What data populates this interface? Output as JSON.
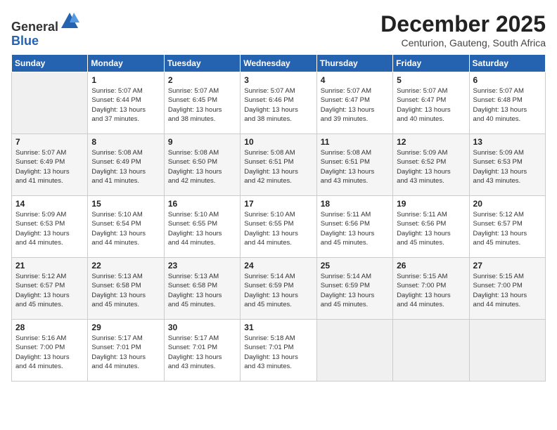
{
  "header": {
    "logo_general": "General",
    "logo_blue": "Blue",
    "month_title": "December 2025",
    "location": "Centurion, Gauteng, South Africa"
  },
  "days_of_week": [
    "Sunday",
    "Monday",
    "Tuesday",
    "Wednesday",
    "Thursday",
    "Friday",
    "Saturday"
  ],
  "weeks": [
    [
      {
        "day": "",
        "empty": true
      },
      {
        "day": "1",
        "sunrise": "Sunrise: 5:07 AM",
        "sunset": "Sunset: 6:44 PM",
        "daylight": "Daylight: 13 hours and 37 minutes."
      },
      {
        "day": "2",
        "sunrise": "Sunrise: 5:07 AM",
        "sunset": "Sunset: 6:45 PM",
        "daylight": "Daylight: 13 hours and 38 minutes."
      },
      {
        "day": "3",
        "sunrise": "Sunrise: 5:07 AM",
        "sunset": "Sunset: 6:46 PM",
        "daylight": "Daylight: 13 hours and 38 minutes."
      },
      {
        "day": "4",
        "sunrise": "Sunrise: 5:07 AM",
        "sunset": "Sunset: 6:47 PM",
        "daylight": "Daylight: 13 hours and 39 minutes."
      },
      {
        "day": "5",
        "sunrise": "Sunrise: 5:07 AM",
        "sunset": "Sunset: 6:47 PM",
        "daylight": "Daylight: 13 hours and 40 minutes."
      },
      {
        "day": "6",
        "sunrise": "Sunrise: 5:07 AM",
        "sunset": "Sunset: 6:48 PM",
        "daylight": "Daylight: 13 hours and 40 minutes."
      }
    ],
    [
      {
        "day": "7",
        "sunrise": "Sunrise: 5:07 AM",
        "sunset": "Sunset: 6:49 PM",
        "daylight": "Daylight: 13 hours and 41 minutes."
      },
      {
        "day": "8",
        "sunrise": "Sunrise: 5:08 AM",
        "sunset": "Sunset: 6:49 PM",
        "daylight": "Daylight: 13 hours and 41 minutes."
      },
      {
        "day": "9",
        "sunrise": "Sunrise: 5:08 AM",
        "sunset": "Sunset: 6:50 PM",
        "daylight": "Daylight: 13 hours and 42 minutes."
      },
      {
        "day": "10",
        "sunrise": "Sunrise: 5:08 AM",
        "sunset": "Sunset: 6:51 PM",
        "daylight": "Daylight: 13 hours and 42 minutes."
      },
      {
        "day": "11",
        "sunrise": "Sunrise: 5:08 AM",
        "sunset": "Sunset: 6:51 PM",
        "daylight": "Daylight: 13 hours and 43 minutes."
      },
      {
        "day": "12",
        "sunrise": "Sunrise: 5:09 AM",
        "sunset": "Sunset: 6:52 PM",
        "daylight": "Daylight: 13 hours and 43 minutes."
      },
      {
        "day": "13",
        "sunrise": "Sunrise: 5:09 AM",
        "sunset": "Sunset: 6:53 PM",
        "daylight": "Daylight: 13 hours and 43 minutes."
      }
    ],
    [
      {
        "day": "14",
        "sunrise": "Sunrise: 5:09 AM",
        "sunset": "Sunset: 6:53 PM",
        "daylight": "Daylight: 13 hours and 44 minutes."
      },
      {
        "day": "15",
        "sunrise": "Sunrise: 5:10 AM",
        "sunset": "Sunset: 6:54 PM",
        "daylight": "Daylight: 13 hours and 44 minutes."
      },
      {
        "day": "16",
        "sunrise": "Sunrise: 5:10 AM",
        "sunset": "Sunset: 6:55 PM",
        "daylight": "Daylight: 13 hours and 44 minutes."
      },
      {
        "day": "17",
        "sunrise": "Sunrise: 5:10 AM",
        "sunset": "Sunset: 6:55 PM",
        "daylight": "Daylight: 13 hours and 44 minutes."
      },
      {
        "day": "18",
        "sunrise": "Sunrise: 5:11 AM",
        "sunset": "Sunset: 6:56 PM",
        "daylight": "Daylight: 13 hours and 45 minutes."
      },
      {
        "day": "19",
        "sunrise": "Sunrise: 5:11 AM",
        "sunset": "Sunset: 6:56 PM",
        "daylight": "Daylight: 13 hours and 45 minutes."
      },
      {
        "day": "20",
        "sunrise": "Sunrise: 5:12 AM",
        "sunset": "Sunset: 6:57 PM",
        "daylight": "Daylight: 13 hours and 45 minutes."
      }
    ],
    [
      {
        "day": "21",
        "sunrise": "Sunrise: 5:12 AM",
        "sunset": "Sunset: 6:57 PM",
        "daylight": "Daylight: 13 hours and 45 minutes."
      },
      {
        "day": "22",
        "sunrise": "Sunrise: 5:13 AM",
        "sunset": "Sunset: 6:58 PM",
        "daylight": "Daylight: 13 hours and 45 minutes."
      },
      {
        "day": "23",
        "sunrise": "Sunrise: 5:13 AM",
        "sunset": "Sunset: 6:58 PM",
        "daylight": "Daylight: 13 hours and 45 minutes."
      },
      {
        "day": "24",
        "sunrise": "Sunrise: 5:14 AM",
        "sunset": "Sunset: 6:59 PM",
        "daylight": "Daylight: 13 hours and 45 minutes."
      },
      {
        "day": "25",
        "sunrise": "Sunrise: 5:14 AM",
        "sunset": "Sunset: 6:59 PM",
        "daylight": "Daylight: 13 hours and 45 minutes."
      },
      {
        "day": "26",
        "sunrise": "Sunrise: 5:15 AM",
        "sunset": "Sunset: 7:00 PM",
        "daylight": "Daylight: 13 hours and 44 minutes."
      },
      {
        "day": "27",
        "sunrise": "Sunrise: 5:15 AM",
        "sunset": "Sunset: 7:00 PM",
        "daylight": "Daylight: 13 hours and 44 minutes."
      }
    ],
    [
      {
        "day": "28",
        "sunrise": "Sunrise: 5:16 AM",
        "sunset": "Sunset: 7:00 PM",
        "daylight": "Daylight: 13 hours and 44 minutes."
      },
      {
        "day": "29",
        "sunrise": "Sunrise: 5:17 AM",
        "sunset": "Sunset: 7:01 PM",
        "daylight": "Daylight: 13 hours and 44 minutes."
      },
      {
        "day": "30",
        "sunrise": "Sunrise: 5:17 AM",
        "sunset": "Sunset: 7:01 PM",
        "daylight": "Daylight: 13 hours and 43 minutes."
      },
      {
        "day": "31",
        "sunrise": "Sunrise: 5:18 AM",
        "sunset": "Sunset: 7:01 PM",
        "daylight": "Daylight: 13 hours and 43 minutes."
      },
      {
        "day": "",
        "empty": true
      },
      {
        "day": "",
        "empty": true
      },
      {
        "day": "",
        "empty": true
      }
    ]
  ]
}
